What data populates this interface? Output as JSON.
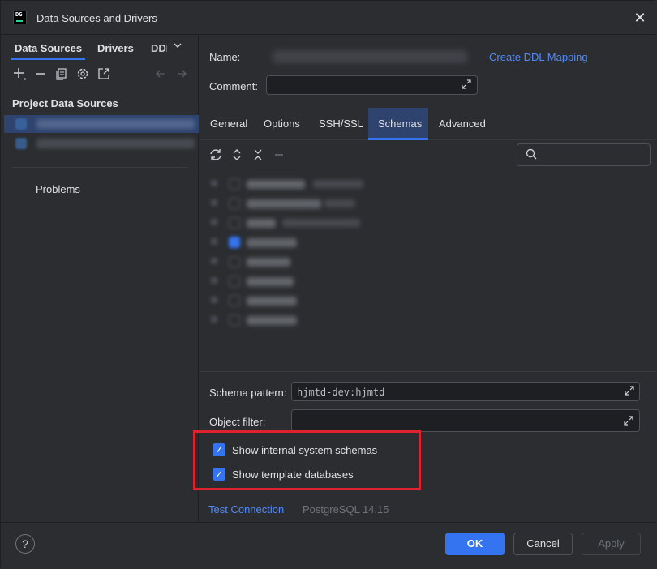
{
  "window": {
    "title": "Data Sources and Drivers",
    "app_logo": "DG",
    "close_glyph": "✕"
  },
  "left_panel": {
    "tabs": [
      {
        "label": "Data Sources",
        "active": true
      },
      {
        "label": "Drivers",
        "active": false
      },
      {
        "label": "DDL",
        "active": false
      }
    ],
    "tabs_more_glyph": "⌵",
    "toolbar_icons": [
      "add-icon",
      "remove-icon",
      "duplicate-icon",
      "settings-icon",
      "open-external-icon",
      "back-icon",
      "forward-icon"
    ],
    "section_title": "Project Data Sources",
    "problems_label": "Problems"
  },
  "form": {
    "name_label": "Name:",
    "create_ddl_link": "Create DDL Mapping",
    "comment_label": "Comment:",
    "comment_value": ""
  },
  "tabs": [
    {
      "label": "General",
      "active": false
    },
    {
      "label": "Options",
      "active": false
    },
    {
      "label": "SSH/SSL",
      "active": false
    },
    {
      "label": "Schemas",
      "active": true
    },
    {
      "label": "Advanced",
      "active": false
    }
  ],
  "schemas_toolbar": {
    "icons": [
      "refresh-icon",
      "expand-all-icon",
      "collapse-all-icon",
      "minus-icon"
    ],
    "search_placeholder": ""
  },
  "schema_pattern": {
    "label": "Schema pattern:",
    "value": "hjmtd-dev:hjmtd"
  },
  "object_filter": {
    "label": "Object filter:",
    "value": ""
  },
  "options": [
    {
      "label": "Show internal system schemas",
      "checked": true
    },
    {
      "label": "Show template databases",
      "checked": true
    }
  ],
  "test_connection": {
    "link": "Test Connection",
    "driver_version": "PostgreSQL 14.15"
  },
  "footer": {
    "help_glyph": "?",
    "ok": "OK",
    "cancel": "Cancel",
    "apply": "Apply"
  },
  "colors": {
    "background": "#2b2d30",
    "accent": "#3574f0",
    "link": "#548af7",
    "highlight_box": "#e0212e"
  }
}
